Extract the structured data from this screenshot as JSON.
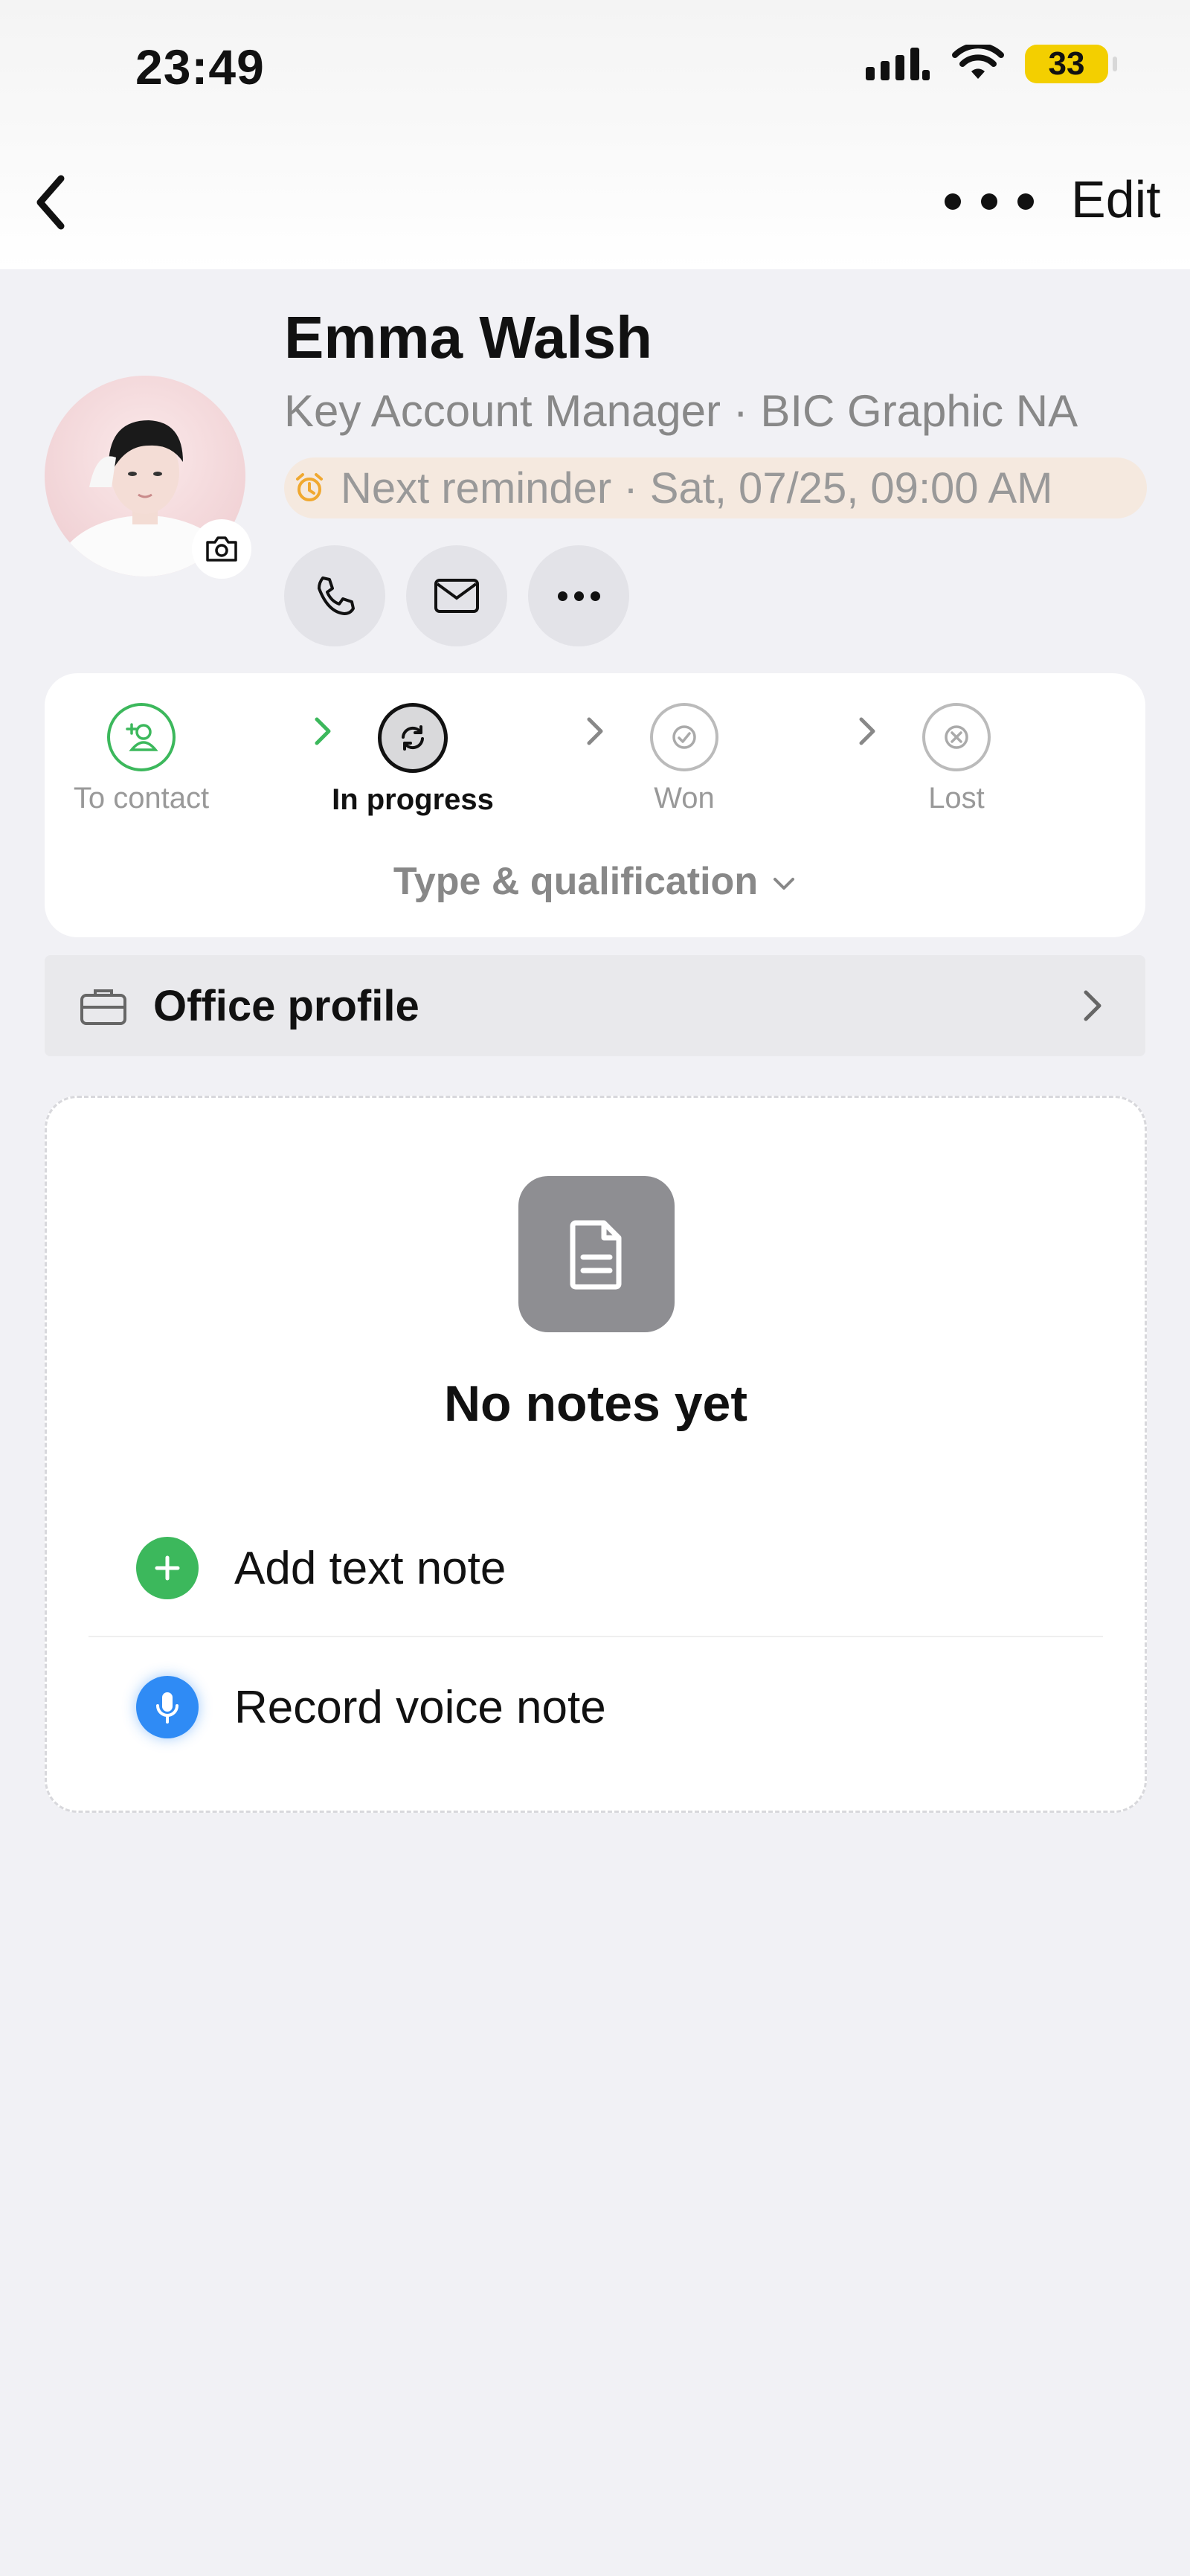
{
  "status_bar": {
    "time": "23:49",
    "battery": "33"
  },
  "nav": {
    "edit_label": "Edit"
  },
  "contact": {
    "name": "Emma Walsh",
    "role": "Key Account Manager · BIC Graphic NA",
    "reminder": "Next reminder · Sat, 07/25, 09:00 AM"
  },
  "pipeline": {
    "stages": [
      {
        "label": "To contact",
        "state": "done"
      },
      {
        "label": "In progress",
        "state": "current"
      },
      {
        "label": "Won",
        "state": "pending"
      },
      {
        "label": "Lost",
        "state": "pending"
      }
    ],
    "toggle_label": "Type & qualification"
  },
  "office_profile": {
    "label": "Office profile"
  },
  "notes": {
    "empty_label": "No notes yet",
    "add_text_label": "Add text note",
    "record_voice_label": "Record voice note"
  },
  "colors": {
    "green": "#3cb85c",
    "blue": "#2f8bf5",
    "reminder_bg": "#f5e9df",
    "battery": "#f3cf00"
  }
}
